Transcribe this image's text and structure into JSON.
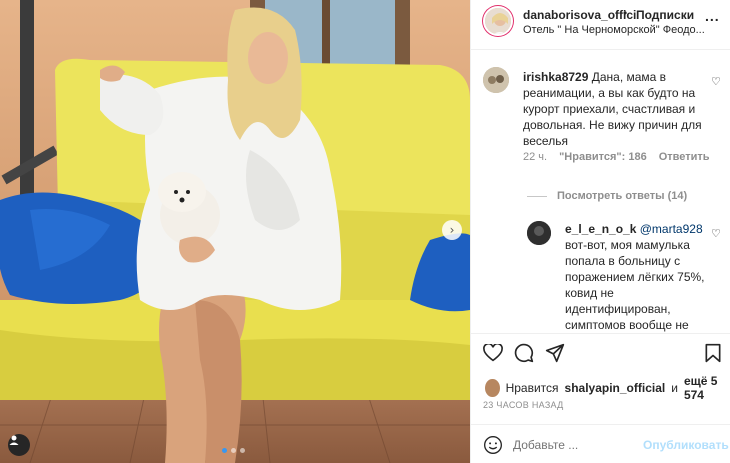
{
  "photo": {
    "description_icons": [
      "chevron-right-icon",
      "user-tag-icon"
    ],
    "carousel_dots": 3,
    "carousel_active": 1
  },
  "header": {
    "username": "danaborisova_offici",
    "separator": "•",
    "follow_label": "Подписки",
    "location": "Отель \" На Черноморской\" Феодо...",
    "more": "..."
  },
  "comments": [
    {
      "username": "irishka8729",
      "text": "Дана, мама в реанимации, а вы как будто на курорт приехали, счастливая и довольная. Не вижу причин для веселья",
      "time": "22 ч.",
      "likes": "\"Нравится\": 186",
      "reply_label": "Ответить"
    }
  ],
  "replies": {
    "toggle_label": "Посмотреть ответы (14)",
    "items": [
      {
        "username": "e_l_e_n_o_k",
        "mention": "@marta928",
        "text": "вот-вот, моя мамулька попала в больницу с поражением лёгких 75%, ковид не идентифицирован, симптомов вообще не было дома, резко стала"
      }
    ]
  },
  "likes": {
    "prefix": "Нравится",
    "user": "shalyapin_official",
    "conjunction": "и",
    "more": "ещё 5 574"
  },
  "timestamp": "23 ЧАСОВ НАЗАД",
  "add_comment": {
    "placeholder": "Добавьте ...",
    "post_label": "Опубликовать"
  },
  "colors": {
    "link_blue": "#00376b",
    "post_disabled": "#b2dffc",
    "secondary_text": "#8e8e8e"
  }
}
